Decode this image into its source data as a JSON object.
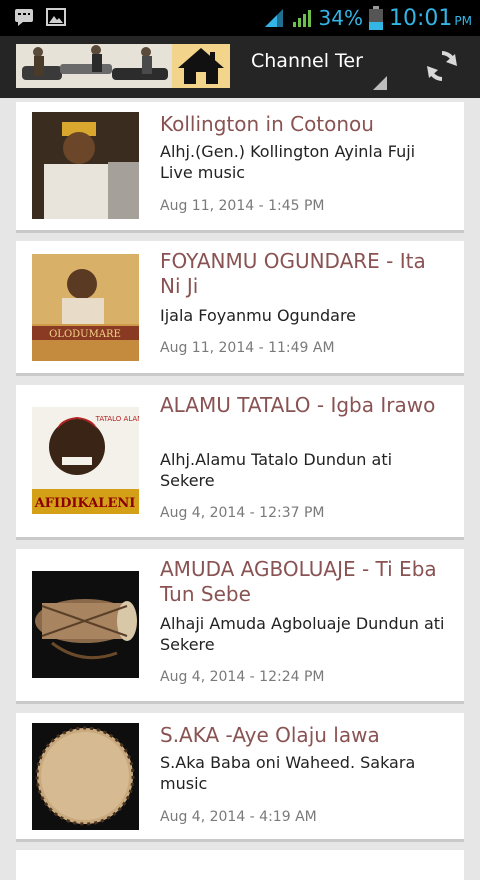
{
  "status_bar": {
    "battery": "34%",
    "time": "10:01",
    "ampm": "PM"
  },
  "action_bar": {
    "channel": "Channel Ter"
  },
  "items": [
    {
      "title": "Kollington in Cotonou",
      "subtitle": "Alhj.(Gen.) Kollington Ayinla Fuji Live music",
      "date": "Aug 11, 2014 - 1:45 PM"
    },
    {
      "title": "FOYANMU OGUNDARE - Ita Ni Ji",
      "subtitle": "Ijala Foyanmu Ogundare",
      "date": "Aug 11, 2014 - 11:49 AM",
      "thumb_text": "OLODUMARE"
    },
    {
      "title": "ALAMU TATALO - Igba Irawo",
      "subtitle": "Alhj.Alamu Tatalo Dundun ati Sekere",
      "date": "Aug 4, 2014 - 12:37 PM",
      "thumb_text": "AFIDIKALENI",
      "thumb_badge": "TATALO ALAMU"
    },
    {
      "title": "AMUDA AGBOLUAJE - Ti Eba Tun Sebe",
      "subtitle": "Alhaji Amuda Agboluaje Dundun ati Sekere",
      "date": "Aug 4, 2014 - 12:24 PM"
    },
    {
      "title": "S.AKA -Aye Olaju lawa",
      "subtitle": "S.Aka Baba oni Waheed. Sakara music",
      "date": "Aug 4, 2014 - 4:19 AM"
    }
  ]
}
